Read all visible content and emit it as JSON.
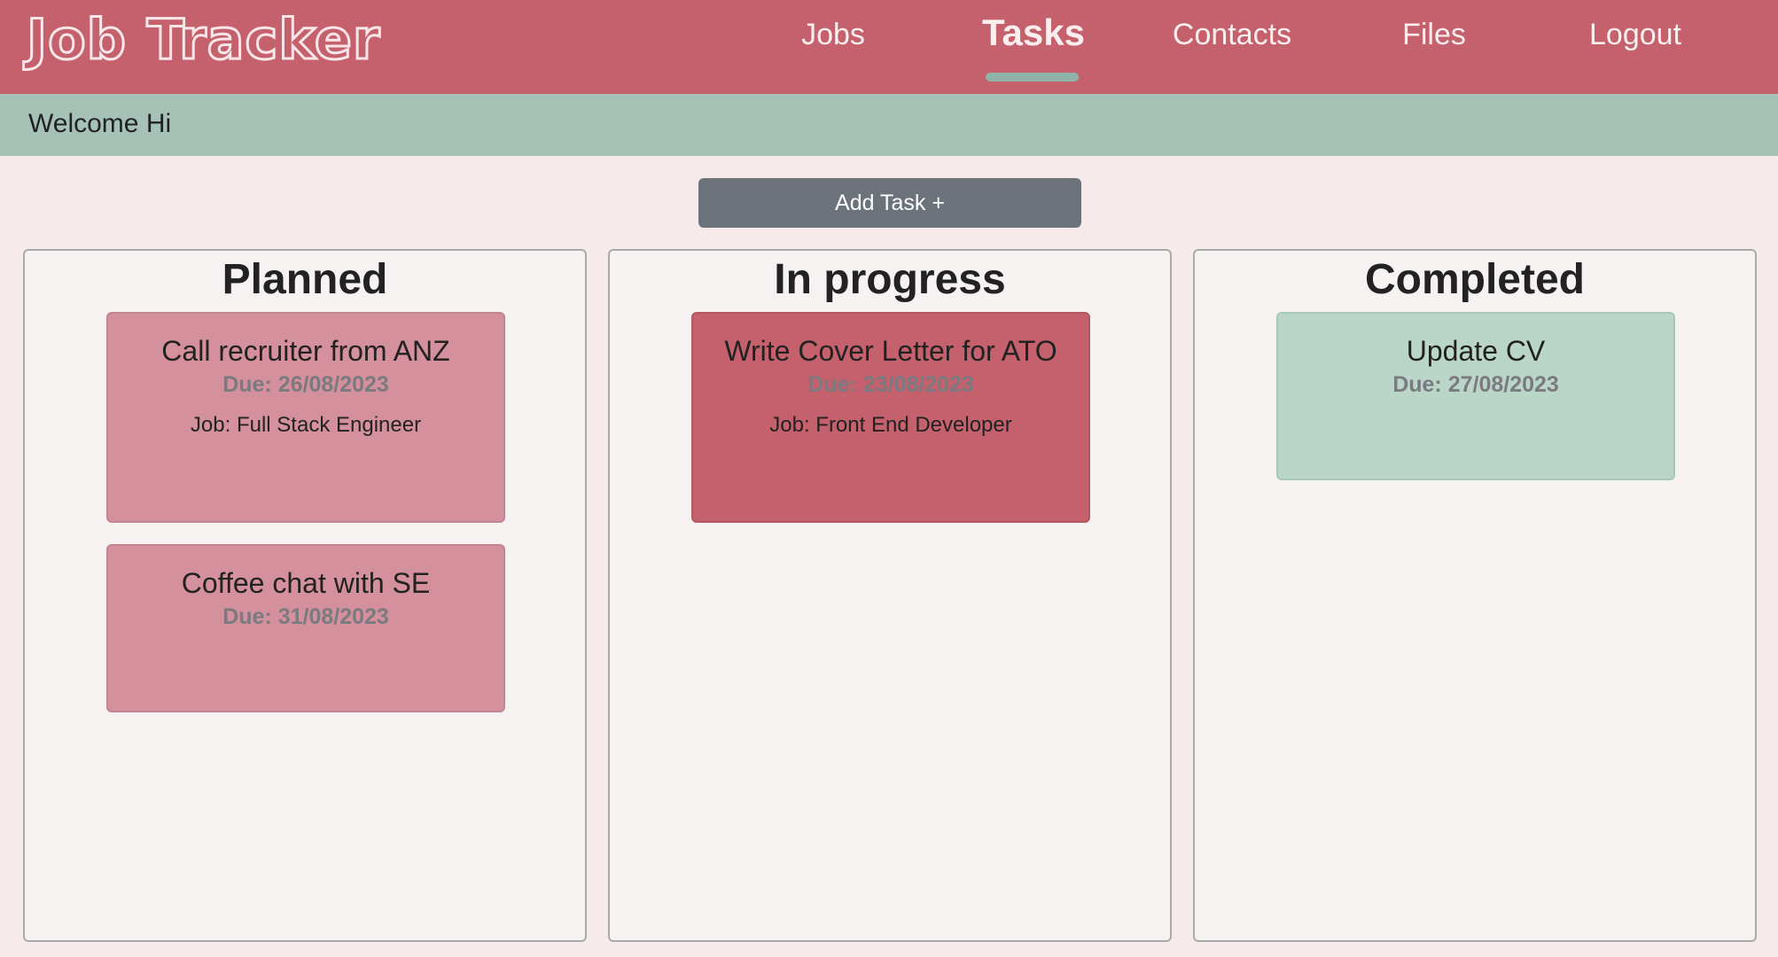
{
  "brand": "Job Tracker",
  "nav": {
    "items": [
      {
        "label": "Jobs"
      },
      {
        "label": "Tasks"
      },
      {
        "label": "Contacts"
      },
      {
        "label": "Files"
      },
      {
        "label": "Logout"
      }
    ],
    "active": "Tasks"
  },
  "welcome": "Welcome Hi",
  "add_task_label": "Add Task +",
  "columns": [
    {
      "title": "Planned",
      "cards": [
        {
          "title": "Call recruiter from ANZ",
          "due": "Due: 26/08/2023",
          "job": "Job: Full Stack Engineer"
        },
        {
          "title": "Coffee chat with SE",
          "due": "Due: 31/08/2023"
        }
      ]
    },
    {
      "title": "In progress",
      "cards": [
        {
          "title": "Write Cover Letter for ATO",
          "due": "Due: 23/08/2023",
          "job": "Job: Front End Developer"
        }
      ]
    },
    {
      "title": "Completed",
      "cards": [
        {
          "title": "Update CV",
          "due": "Due: 27/08/2023"
        }
      ]
    }
  ],
  "colors": {
    "navbar": "#c4616c",
    "welcome_bar": "#a6c2b7",
    "page_bg": "#f6eaea",
    "planned_card": "#d4909c",
    "in_progress_card": "#c4616c",
    "completed_card": "#b9d6c9",
    "add_button": "#6c737b",
    "active_tab_indicator": "#8fb3a8"
  }
}
